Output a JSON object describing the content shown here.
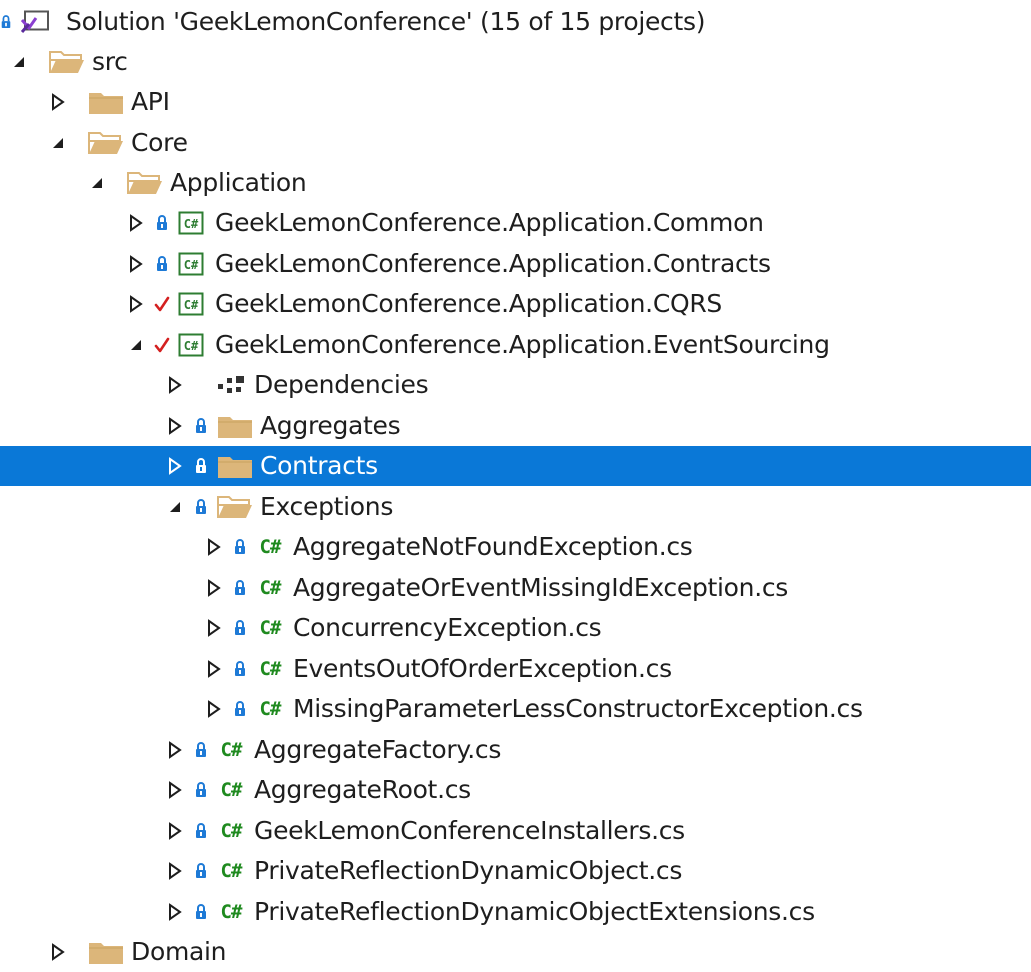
{
  "solution_explorer": {
    "rows": [
      {
        "label": "Solution 'GeekLemonConference' (15 of 15 projects)",
        "icon": "solution-icon",
        "toggle": "none",
        "status": "lock"
      },
      {
        "label": "src",
        "icon": "folder-open-icon",
        "toggle": "expanded"
      },
      {
        "label": "API",
        "icon": "folder-icon",
        "toggle": "collapsed"
      },
      {
        "label": "Core",
        "icon": "folder-open-icon",
        "toggle": "expanded"
      },
      {
        "label": "Application",
        "icon": "folder-open-icon",
        "toggle": "expanded"
      },
      {
        "label": "GeekLemonConference.Application.Common",
        "icon": "csharp-project-icon",
        "toggle": "collapsed",
        "status": "lock"
      },
      {
        "label": "GeekLemonConference.Application.Contracts",
        "icon": "csharp-project-icon",
        "toggle": "collapsed",
        "status": "lock"
      },
      {
        "label": "GeekLemonConference.Application.CQRS",
        "icon": "csharp-project-icon",
        "toggle": "collapsed",
        "status": "check"
      },
      {
        "label": "GeekLemonConference.Application.EventSourcing",
        "icon": "csharp-project-icon",
        "toggle": "expanded",
        "status": "check"
      },
      {
        "label": "Dependencies",
        "icon": "dependencies-icon",
        "toggle": "collapsed"
      },
      {
        "label": "Aggregates",
        "icon": "folder-icon",
        "toggle": "collapsed",
        "status": "lock"
      },
      {
        "label": "Contracts",
        "icon": "folder-icon",
        "toggle": "collapsed",
        "status": "lock",
        "selected": true
      },
      {
        "label": "Exceptions",
        "icon": "folder-open-icon",
        "toggle": "expanded",
        "status": "lock"
      },
      {
        "label": "AggregateNotFoundException.cs",
        "icon": "csharp-file-icon",
        "toggle": "collapsed",
        "status": "lock"
      },
      {
        "label": "AggregateOrEventMissingIdException.cs",
        "icon": "csharp-file-icon",
        "toggle": "collapsed",
        "status": "lock"
      },
      {
        "label": "ConcurrencyException.cs",
        "icon": "csharp-file-icon",
        "toggle": "collapsed",
        "status": "lock"
      },
      {
        "label": "EventsOutOfOrderException.cs",
        "icon": "csharp-file-icon",
        "toggle": "collapsed",
        "status": "lock"
      },
      {
        "label": "MissingParameterLessConstructorException.cs",
        "icon": "csharp-file-icon",
        "toggle": "collapsed",
        "status": "lock"
      },
      {
        "label": "AggregateFactory.cs",
        "icon": "csharp-file-icon",
        "toggle": "collapsed",
        "status": "lock"
      },
      {
        "label": "AggregateRoot.cs",
        "icon": "csharp-file-icon",
        "toggle": "collapsed",
        "status": "lock"
      },
      {
        "label": "GeekLemonConferenceInstallers.cs",
        "icon": "csharp-file-icon",
        "toggle": "collapsed",
        "status": "lock"
      },
      {
        "label": "PrivateReflectionDynamicObject.cs",
        "icon": "csharp-file-icon",
        "toggle": "collapsed",
        "status": "lock"
      },
      {
        "label": "PrivateReflectionDynamicObjectExtensions.cs",
        "icon": "csharp-file-icon",
        "toggle": "collapsed",
        "status": "lock"
      },
      {
        "label": "Domain",
        "icon": "folder-icon",
        "toggle": "collapsed"
      }
    ],
    "colors": {
      "selection": "#0a78d7",
      "folder": "#dcb67a",
      "lock": "#1e7ad6",
      "check": "#d42020",
      "csharp": "#1f8a1f",
      "toggle": "#1e1e1e"
    }
  }
}
